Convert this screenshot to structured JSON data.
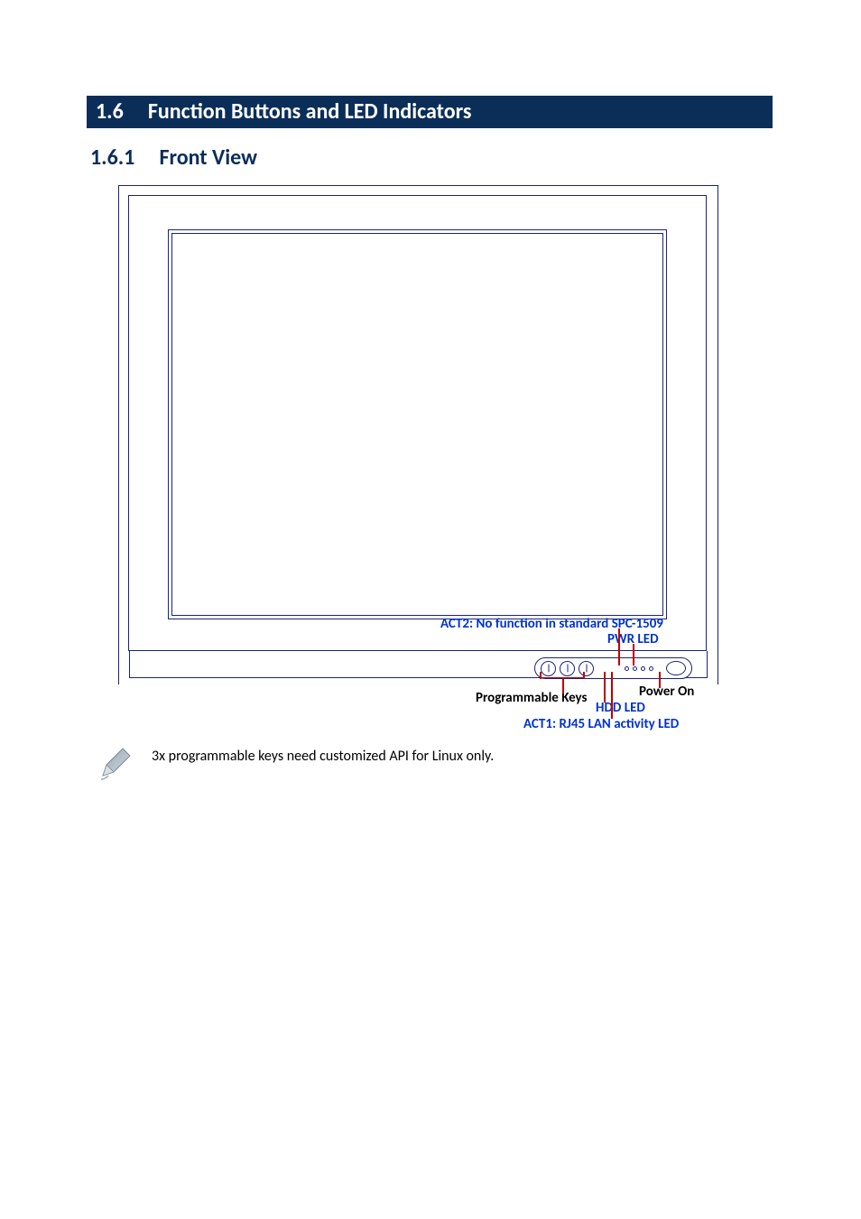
{
  "header": {
    "section_number": "1.6",
    "section_title": "Function Buttons and LED Indicators"
  },
  "subhead": {
    "number": "1.6.1",
    "title": "Front View"
  },
  "diagram": {
    "annotations": {
      "act2": "ACT2: No function in standard SPC-1509",
      "pwr_led": "PWR LED",
      "programmable_keys": "Programmable Keys",
      "power_on": "Power On",
      "hdd_led": "HDD LED",
      "act1": "ACT1: RJ45 LAN activity LED"
    },
    "controls": {
      "prog_key_count": 3,
      "leds": [
        "HDD",
        "ACT1",
        "ACT2",
        "PWR"
      ],
      "power_button": true
    }
  },
  "note": {
    "text": "3x programmable keys need customized API for Linux only."
  }
}
